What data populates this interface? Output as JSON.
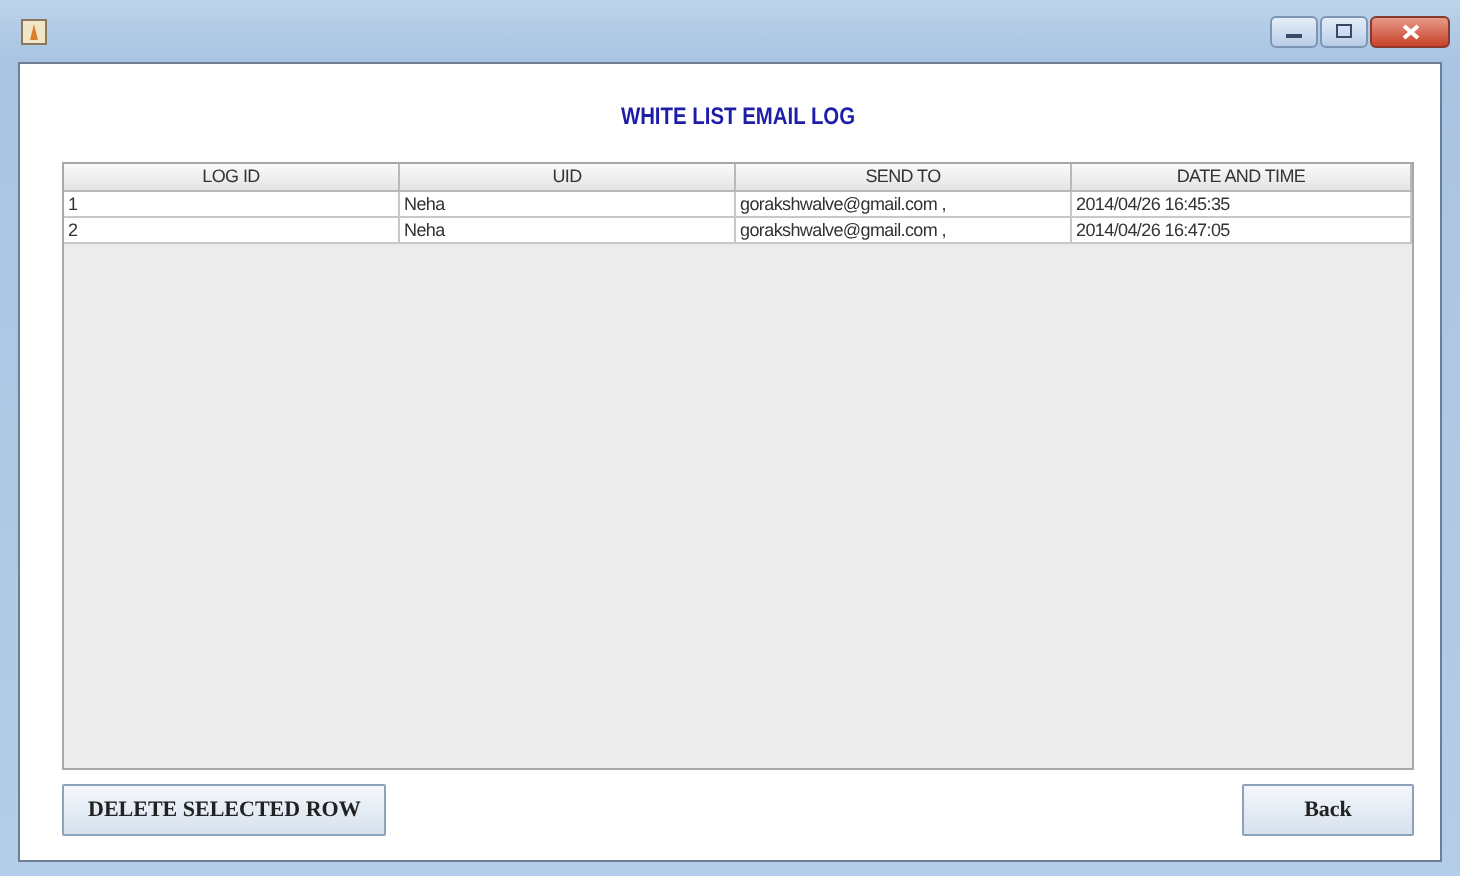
{
  "heading": "WHITE LIST EMAIL LOG",
  "table": {
    "columns": [
      "LOG ID",
      "UID",
      "SEND TO",
      "DATE AND TIME"
    ],
    "rows": [
      [
        "1",
        "Neha",
        "gorakshwalve@gmail.com ,",
        "2014/04/26 16:45:35"
      ],
      [
        "2",
        "Neha",
        "gorakshwalve@gmail.com ,",
        "2014/04/26 16:47:05"
      ]
    ]
  },
  "buttons": [
    "DELETE SELECTED ROW",
    "Back"
  ]
}
